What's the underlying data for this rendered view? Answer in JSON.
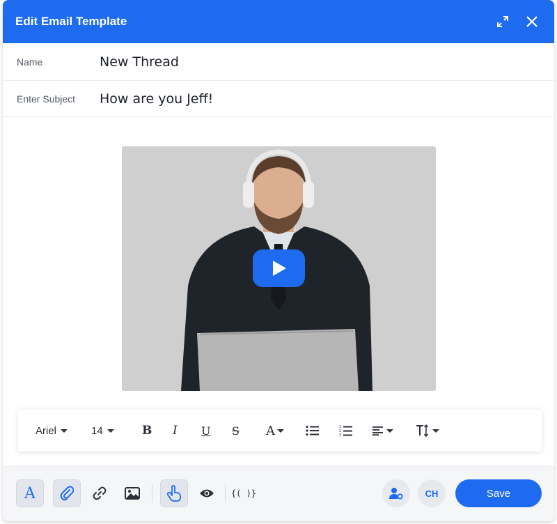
{
  "header": {
    "title": "Edit Email Template",
    "expand_icon": "expand-icon",
    "close_icon": "close-icon"
  },
  "fields": {
    "name_label": "Name",
    "name_value": "New Thread",
    "subject_label": "Enter Subject",
    "subject_value": "How are you Jeff!"
  },
  "video": {
    "play_icon": "play-icon",
    "accent": "#1e6bf0"
  },
  "format_toolbar": {
    "font": "Ariel",
    "size": "14",
    "bold": "B",
    "italic": "I",
    "underline": "U",
    "strike": "S",
    "font_color": "A",
    "text_size_icon": "text-height-icon"
  },
  "bottom_toolbar": {
    "variables": "{( )}",
    "avatar_initials": "CH",
    "save_label": "Save"
  },
  "colors": {
    "primary": "#1e6bf0"
  }
}
